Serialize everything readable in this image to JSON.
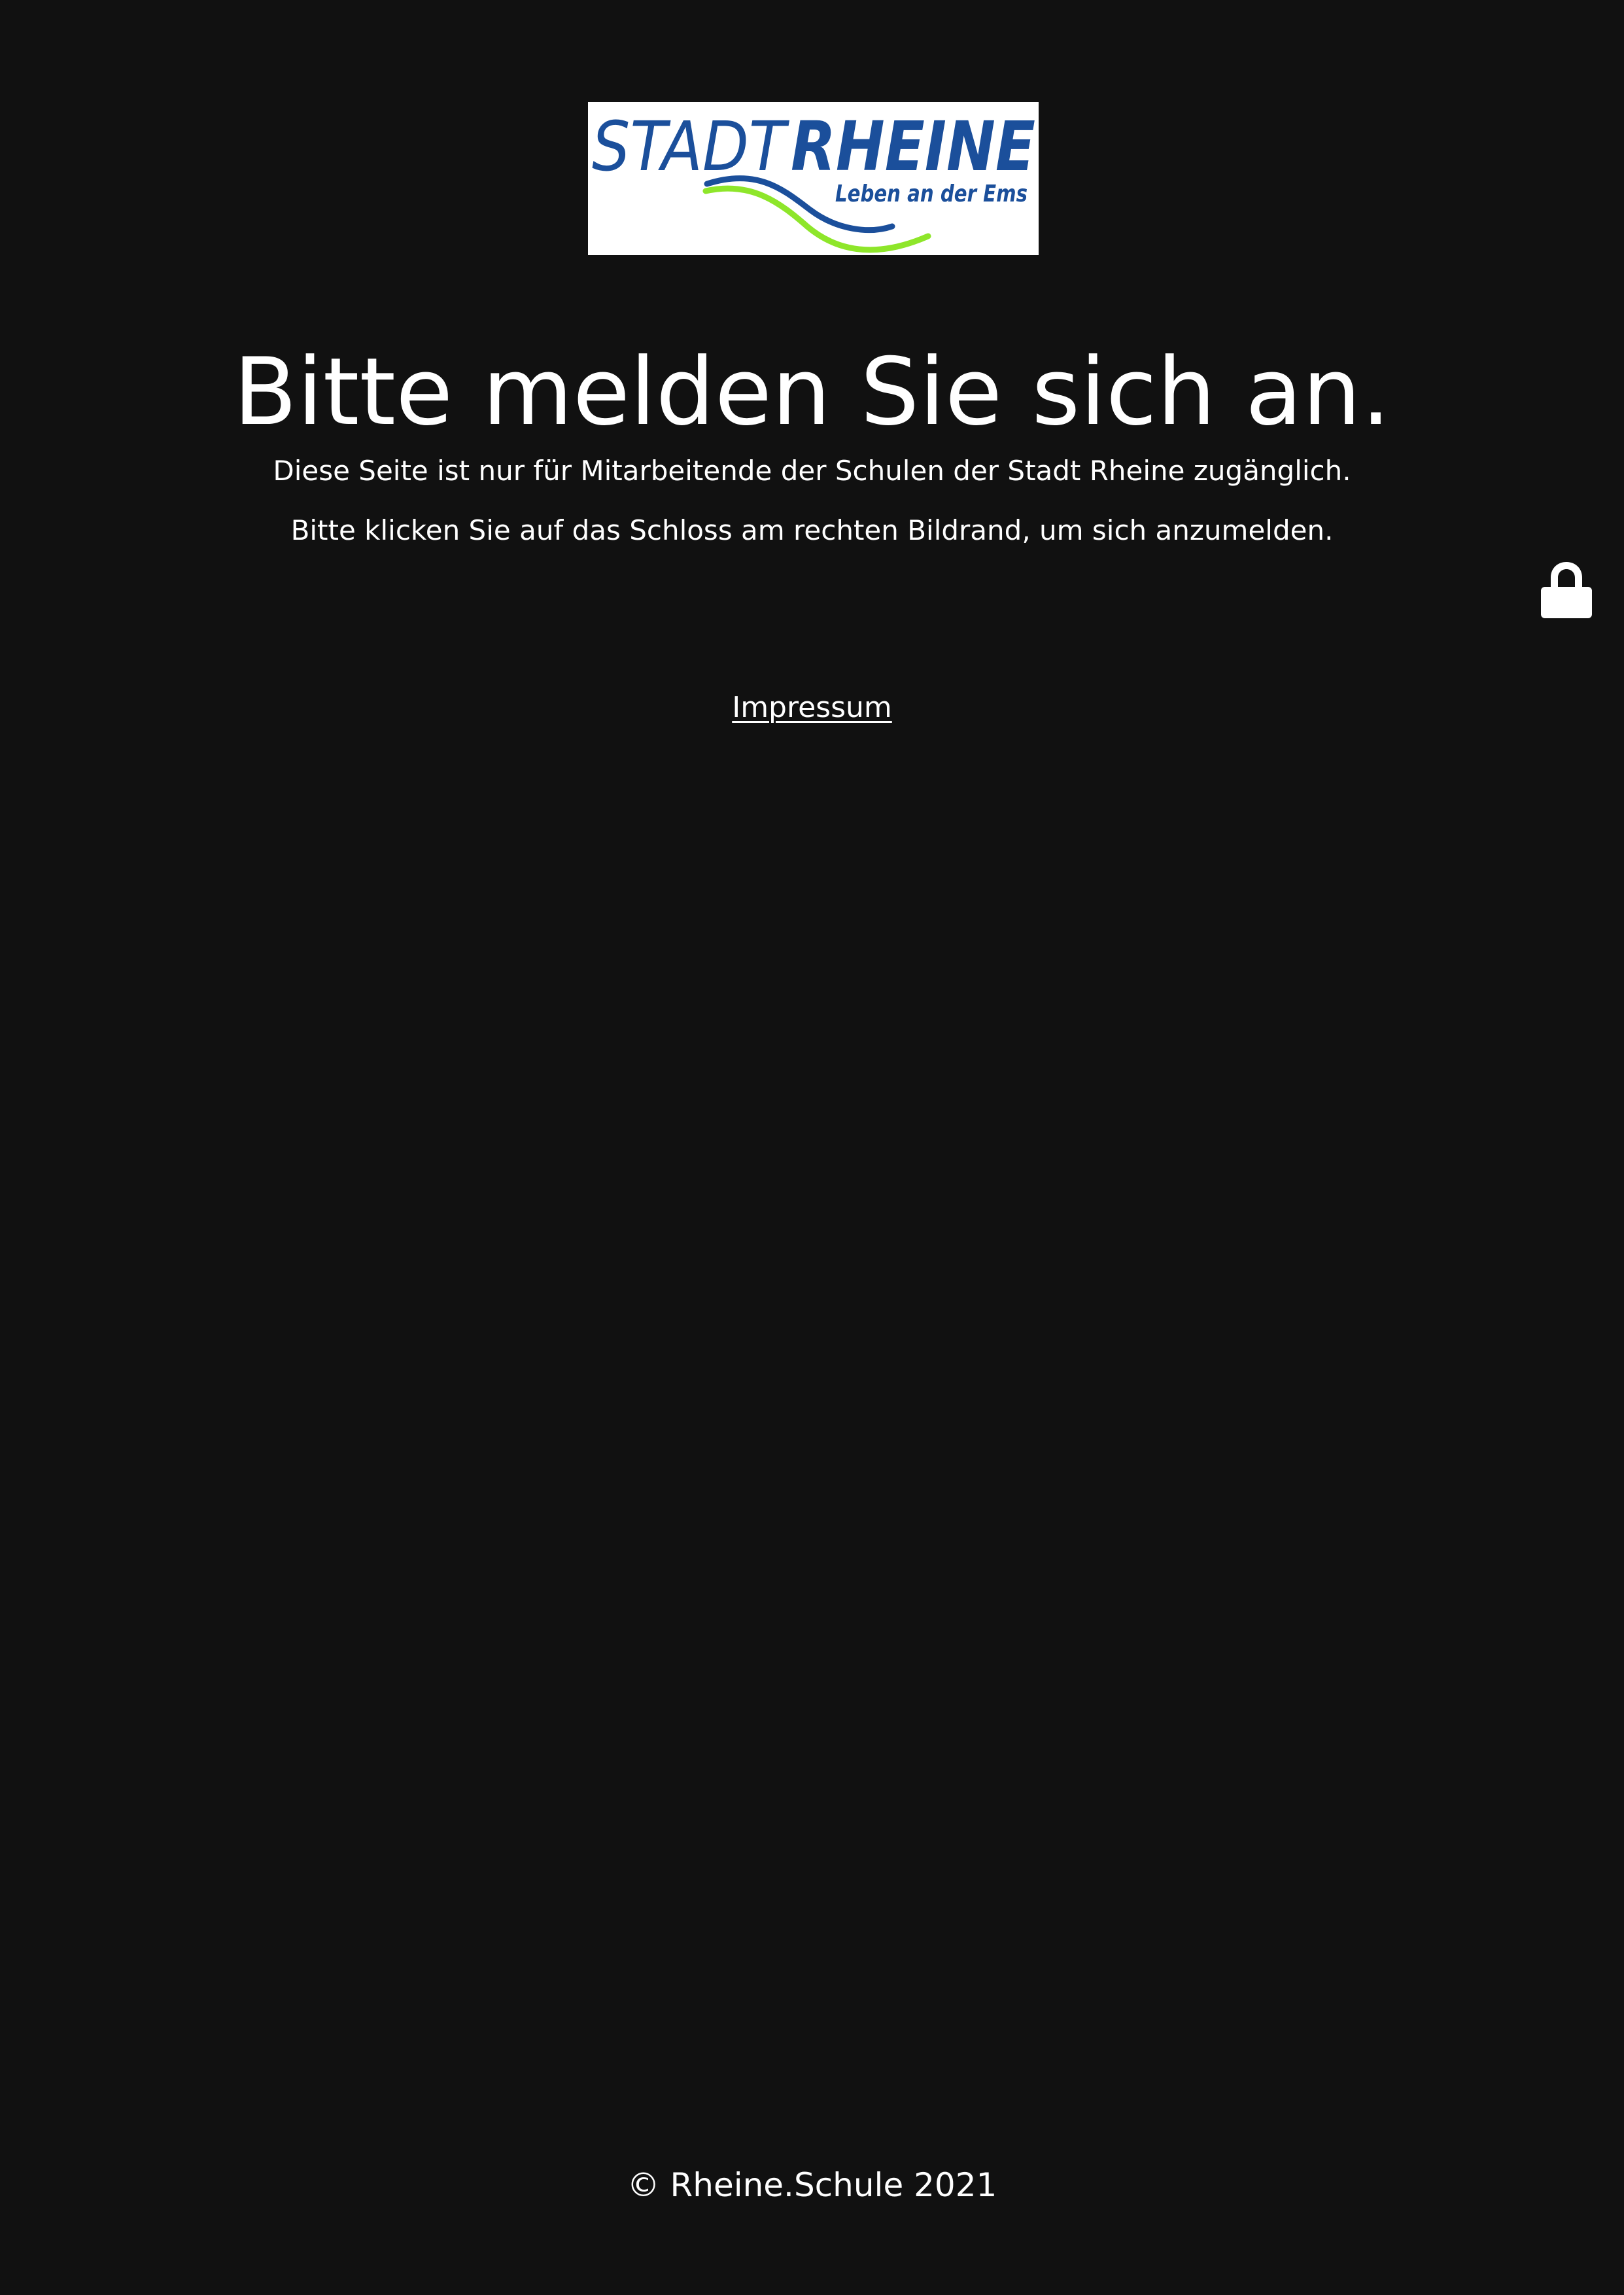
{
  "logo": {
    "word_stadt": "STADT",
    "word_rheine": "RHEINE",
    "tagline": "Leben an der Ems",
    "colors": {
      "text_blue": "#1b4f9b",
      "wave_blue": "#1b4f9b",
      "wave_green": "#8ee62a",
      "background": "#ffffff"
    }
  },
  "main": {
    "headline": "Bitte melden Sie sich an.",
    "description_1": "Diese Seite ist nur für Mitarbeitende der Schulen der Stadt Rheine zugänglich.",
    "description_2": "Bitte klicken Sie auf das Schloss am rechten Bildrand, um sich anzumelden."
  },
  "login": {
    "icon": "lock-icon"
  },
  "links": {
    "impressum": "Impressum"
  },
  "footer": {
    "copyright": "© Rheine.Schule 2021"
  },
  "theme": {
    "background": "#111111",
    "text": "#ffffff"
  }
}
